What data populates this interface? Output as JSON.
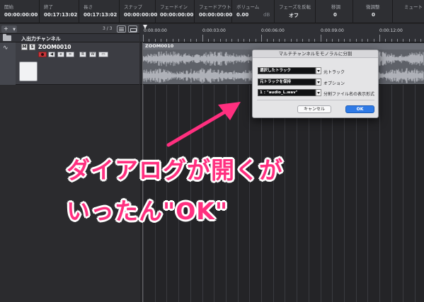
{
  "info_line": {
    "columns": [
      {
        "label": "開始",
        "value": "00:00:00:00"
      },
      {
        "label": "終了",
        "value": "00:17:13:02"
      },
      {
        "label": "長さ",
        "value": "00:17:13:02"
      },
      {
        "label": "スナップ",
        "value": "00:00:00:00"
      },
      {
        "label": "フェードイン",
        "value": "00:00:00:00"
      },
      {
        "label": "フェードアウト",
        "value": "00:00:00:00"
      },
      {
        "label": "ボリューム",
        "value": "0.00",
        "unit": "dB"
      },
      {
        "label": "フェーズを反転",
        "value": "オフ"
      },
      {
        "label": "移調",
        "value": "0"
      },
      {
        "label": "微調整",
        "value": "0"
      },
      {
        "label": "ミュート",
        "value": ""
      }
    ]
  },
  "track_header": {
    "add_label": "+",
    "track_count": "3 / 3",
    "io_channel_name": "入出力チャンネル",
    "audio_track": {
      "mute_label": "M",
      "solo_label": "S",
      "name": "ZOOM0010",
      "control_labels": [
        "",
        "◀",
        "e",
        "∞",
        "R",
        "W",
        "▭"
      ]
    }
  },
  "ruler": {
    "marks": [
      "0:00:00:00",
      "0:00:03:00",
      "0:00:06:00",
      "0:00:09:00",
      "0:00:12:00"
    ]
  },
  "event": {
    "title": "ZOOM0010"
  },
  "dialog": {
    "title": "マルチチャンネルをモノラルに分割",
    "rows": [
      {
        "value": "選択したトラック",
        "label": "元トラック"
      },
      {
        "value": "元トラックを保持",
        "label": "オプション"
      },
      {
        "value": "1 : \"audio_L.wav\"",
        "label": "分割ファイル名の表示形式"
      }
    ],
    "cancel_label": "キャンセル",
    "ok_label": "OK"
  },
  "annotation": {
    "line1": "ダイアログが開くが",
    "line2": "いったん\"OK\"",
    "color": "#ff2f7f"
  }
}
